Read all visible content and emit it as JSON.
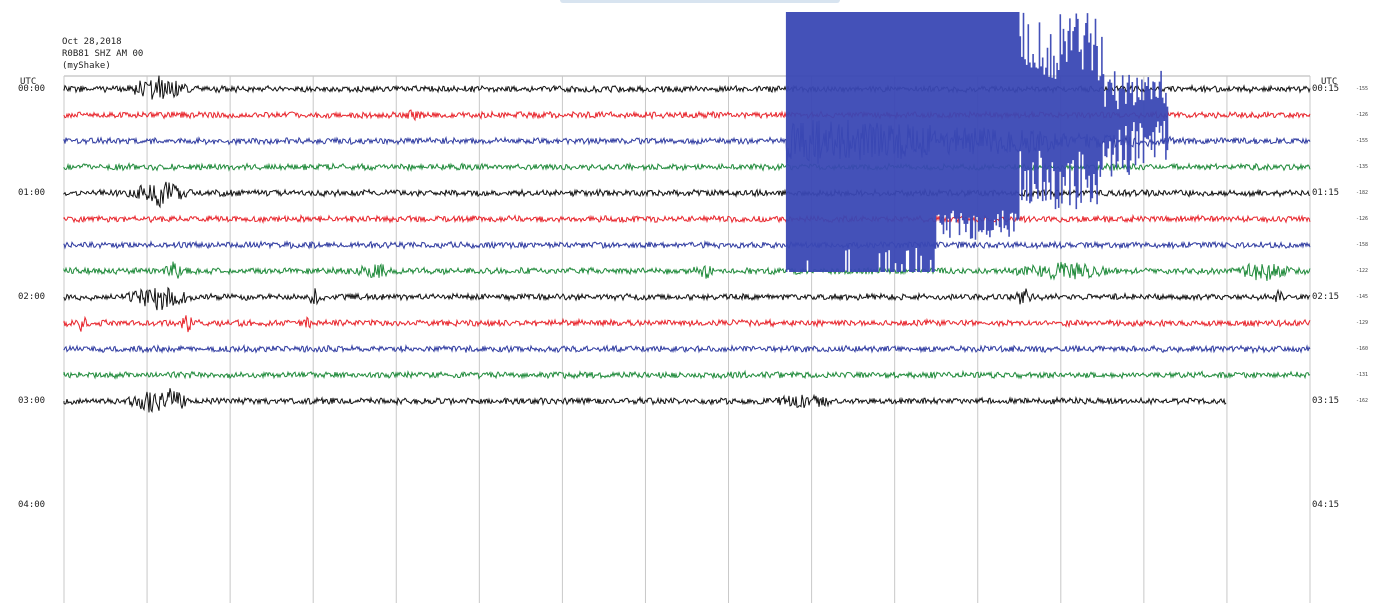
{
  "header": {
    "date": "Oct 28,2018",
    "station": "R0B81 SHZ AM 00",
    "network": "(myShake)"
  },
  "utc_left": "UTC",
  "utc_right": "UTC",
  "left_labels": [
    "00:00",
    "01:00",
    "02:00",
    "03:00",
    "04:00"
  ],
  "right_labels": [
    "00:15",
    "01:15",
    "02:15",
    "03:15",
    "04:15"
  ],
  "scale_values": [
    "-155",
    "-126",
    "-155",
    "-135",
    "-182",
    "-126",
    "-158",
    "-122",
    "-145",
    "-129",
    "-160",
    "-131",
    "-162"
  ],
  "colors": {
    "black": "#111111",
    "red": "#e8242b",
    "blue": "#2e3aa0",
    "green": "#1f8a3a",
    "quake": "#3a48b4",
    "grid": "#c8c8c8"
  },
  "chart_data": {
    "type": "line",
    "title": "Oct 28,2018 R0B81 SHZ AM 00 (myShake)",
    "xlabel": "",
    "ylabel": "UTC",
    "trace_minutes": 15,
    "trace_count": 13,
    "trace_start_times": [
      "00:00",
      "00:15",
      "00:30",
      "00:45",
      "01:00",
      "01:15",
      "01:30",
      "01:45",
      "02:00",
      "02:15",
      "02:30",
      "02:45",
      "03:00"
    ],
    "trace_colors": [
      "black",
      "red",
      "blue",
      "green",
      "black",
      "red",
      "blue",
      "green",
      "black",
      "red",
      "blue",
      "green",
      "black"
    ],
    "last_trace_end_minute": 14,
    "event": {
      "start_time": "00:08.7",
      "saturated_traces": [
        0,
        1,
        2,
        3,
        4,
        5,
        6
      ],
      "saturated_end_minutes": [
        10.9,
        11.5,
        12.5,
        13.3,
        10.5,
        10.5,
        10.5
      ],
      "coda_end_time": "00:28.5",
      "color": "blue"
    },
    "grid": true
  }
}
